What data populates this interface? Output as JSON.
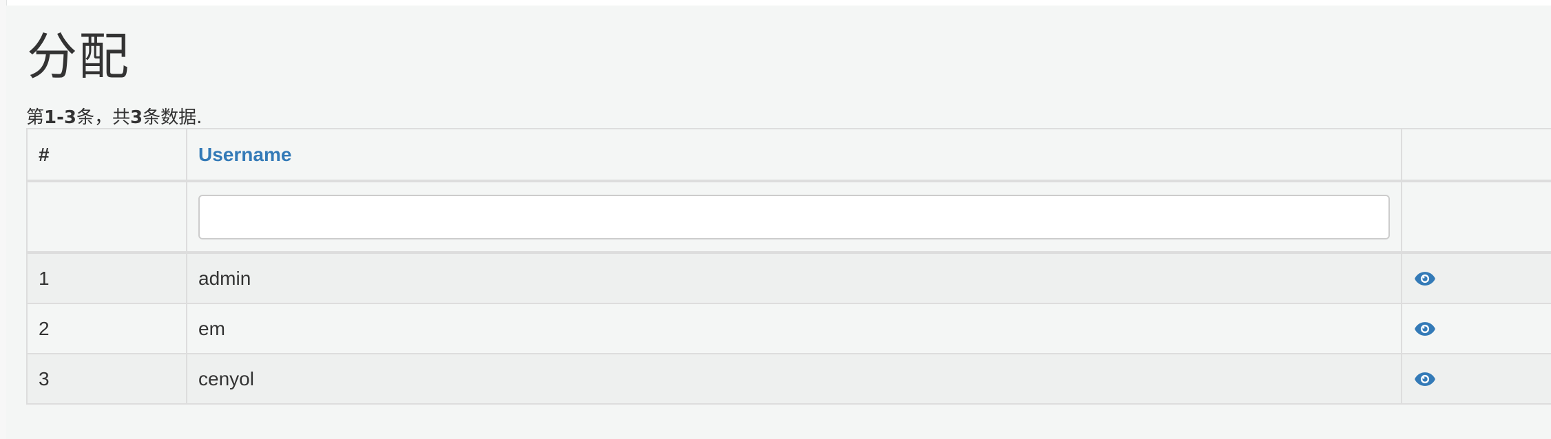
{
  "page": {
    "title": "分配",
    "summary": {
      "prefix": "第",
      "range": "1-3",
      "mid": "条，共",
      "total": "3",
      "suffix": "条数据."
    }
  },
  "table": {
    "columns": {
      "num": "#",
      "username": "Username",
      "actions": ""
    },
    "filter": {
      "username_value": ""
    },
    "rows": [
      {
        "num": "1",
        "username": "admin",
        "action_icon": "eye-icon"
      },
      {
        "num": "2",
        "username": "em",
        "action_icon": "eye-icon"
      },
      {
        "num": "3",
        "username": "cenyol",
        "action_icon": "eye-icon"
      }
    ]
  },
  "colors": {
    "link": "#337ab7",
    "border": "#dddddd",
    "background": "#f4f6f5",
    "stripe": "#eef0ef"
  }
}
